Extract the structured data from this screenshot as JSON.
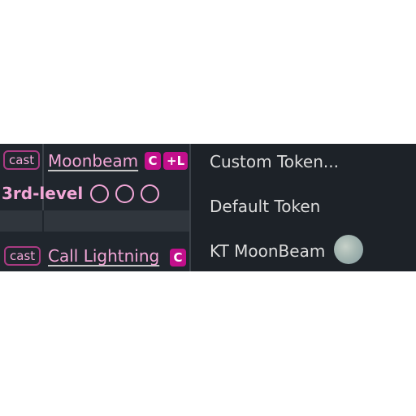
{
  "spell_list": {
    "rows": [
      {
        "cast_label": "cast",
        "name": "Moonbeam",
        "badges": [
          "C",
          "+L"
        ]
      },
      {
        "cast_label": "cast",
        "name": "Call Lightning",
        "badges": [
          "C"
        ]
      }
    ],
    "level_header": {
      "label": "3rd-level",
      "slots_total": 3,
      "slots_used": 0
    }
  },
  "context_menu": {
    "items": [
      "Custom Token...",
      "Default Token",
      "KT MoonBeam"
    ]
  },
  "colors": {
    "panel_bg": "#20262d",
    "menu_bg": "#1d2228",
    "accent_pink": "#f2a7d7",
    "badge_magenta": "#c20f8b",
    "menu_text": "#dcdcdc"
  }
}
